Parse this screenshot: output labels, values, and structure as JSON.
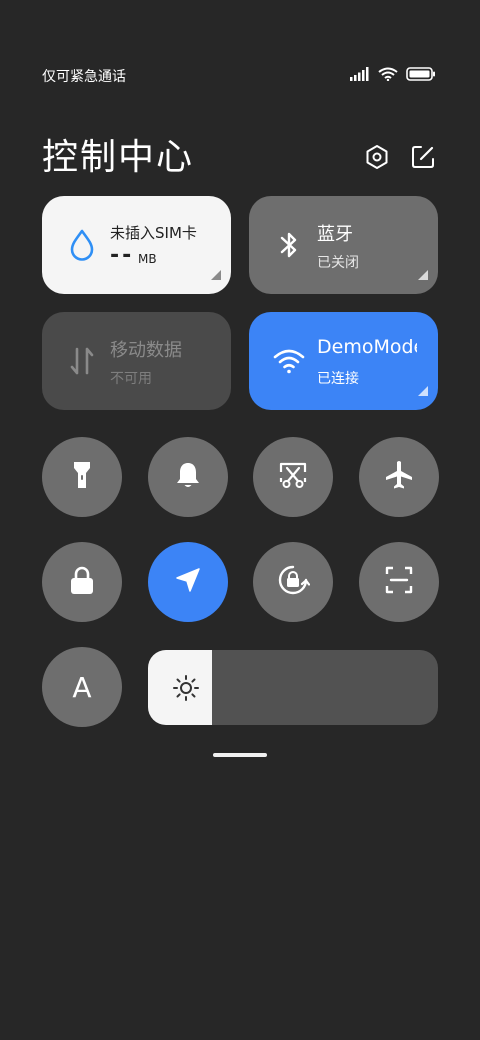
{
  "status_bar": {
    "carrier": "仅可紧急通话",
    "icons": [
      "signal-icon",
      "wifi-icon",
      "battery-icon"
    ]
  },
  "header": {
    "title": "控制中心",
    "settings_icon": "settings-icon",
    "edit_icon": "edit-icon"
  },
  "tiles": {
    "data_usage": {
      "icon": "water-drop-icon",
      "label": "未插入SIM卡",
      "value": "--",
      "unit": "MB"
    },
    "bluetooth": {
      "icon": "bluetooth-icon",
      "label": "蓝牙",
      "status": "已关闭"
    },
    "mobile_data": {
      "icon": "mobile-data-icon",
      "label": "移动数据",
      "status": "不可用"
    },
    "wifi": {
      "icon": "wifi-icon",
      "label": "DemoMode",
      "status": "已连接"
    }
  },
  "toggles": [
    {
      "name": "flashlight",
      "icon": "flashlight-icon",
      "active": false
    },
    {
      "name": "silent",
      "icon": "bell-icon",
      "active": false
    },
    {
      "name": "screenshot",
      "icon": "scissors-icon",
      "active": false
    },
    {
      "name": "airplane-mode",
      "icon": "airplane-icon",
      "active": false
    },
    {
      "name": "lock-screen",
      "icon": "lock-icon",
      "active": false
    },
    {
      "name": "location",
      "icon": "location-arrow-icon",
      "active": true
    },
    {
      "name": "auto-rotate",
      "icon": "rotation-lock-icon",
      "active": false
    },
    {
      "name": "scanner",
      "icon": "scan-icon",
      "active": false
    }
  ],
  "auto_brightness": {
    "label": "A",
    "icon": "auto-brightness-icon"
  },
  "brightness": {
    "icon": "sun-icon",
    "level_percent": 22
  },
  "colors": {
    "background": "#272727",
    "tile_inactive": "#6e6e6e",
    "tile_active_blue": "#3c84f6",
    "tile_white": "#f5f5f5"
  }
}
